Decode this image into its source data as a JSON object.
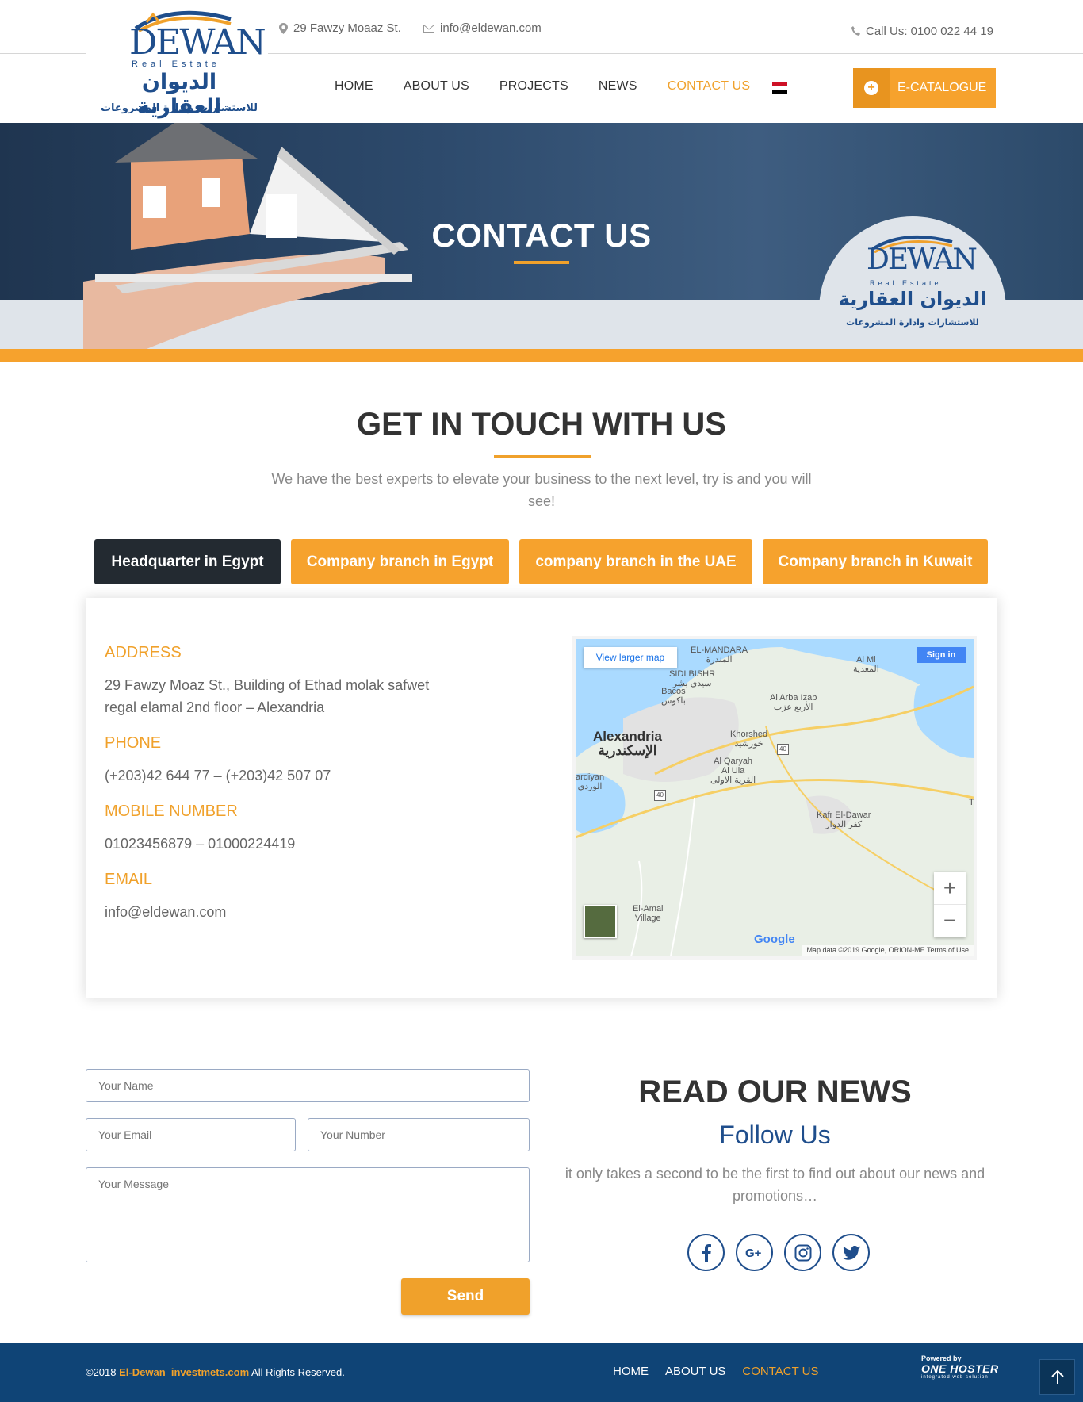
{
  "header": {
    "address": "29 Fawzy Moaaz St.",
    "email": "info@eldewan.com",
    "call": "Call Us: 0100 022 44 19",
    "logo": {
      "latin": "DEWAN",
      "subtitle": "Real Estate",
      "arabic_name": "الديوان العقارية",
      "arabic_tagline": "للاستشارات وادارة المشروعات"
    }
  },
  "nav": {
    "items": [
      {
        "label": "HOME"
      },
      {
        "label": "ABOUT US"
      },
      {
        "label": "PROJECTS"
      },
      {
        "label": "NEWS"
      },
      {
        "label": "CONTACT US",
        "active": true
      }
    ],
    "flag": "egypt-flag",
    "ecatalogue": "E-CATALOGUE"
  },
  "hero": {
    "title": "CONTACT US"
  },
  "contact": {
    "title": "GET IN TOUCH WITH US",
    "intro": "We have the best experts to elevate your business to the next level, try is and you will see!",
    "tabs": [
      {
        "label": "Headquarter in Egypt",
        "active": true
      },
      {
        "label": "Company branch in Egypt"
      },
      {
        "label": "company branch in the UAE"
      },
      {
        "label": "Company branch in Kuwait"
      }
    ],
    "address_label": "ADDRESS",
    "address_line1": "29 Fawzy Moaz St., Building of Ethad molak safwet",
    "address_line2": "regal elamal 2nd floor – Alexandria",
    "phone_label": "PHONE",
    "phone": "(+203)42 644 77 – (+203)42 507 07",
    "mobile_label": "MOBILE NUMBER",
    "mobile": "01023456879 – 01000224419",
    "email_label": "EMAIL",
    "email": "info@eldewan.com"
  },
  "map": {
    "view_larger": "View larger map",
    "sign_in": "Sign in",
    "labels": {
      "mandara": "EL-MANDARA",
      "mandara_ar": "المندرة",
      "sidi_bishr": "SIDI BISHR",
      "sidi_bishr_ar": "سيدي بشر",
      "al_mi": "Al Mi",
      "al_mi_ar": "المعدية",
      "bacos": "Bacos",
      "bacos_ar": "باكوس",
      "arba_izab": "Al Arba Izab",
      "arba_izab_ar": "الأربع عزب",
      "alexandria": "Alexandria",
      "alexandria_ar": "الإسكندرية",
      "khorshed": "Khorshed",
      "khorshed_ar": "خورشيد",
      "qaryah1": "Al Qaryah",
      "qaryah2": "Al Ula",
      "qaryah_ar": "القرية الاولى",
      "ardiyan": "ardiyan",
      "ardiyan_ar": "الوردي",
      "kafr": "Kafr El-Dawar",
      "kafr_ar": "كفر الدوار",
      "amal1": "El-Amal",
      "amal2": "Village",
      "road1": "40",
      "road2": "40",
      "t": "T"
    },
    "zoom_in": "+",
    "zoom_out": "−",
    "google": "Google",
    "credits": "Map data ©2019 Google, ORION-ME    Terms of Use"
  },
  "form": {
    "name_placeholder": "Your Name",
    "email_placeholder": "Your Email",
    "number_placeholder": "Your Number",
    "message_placeholder": "Your Message",
    "send": "Send"
  },
  "news": {
    "title": "READ OUR NEWS",
    "follow": "Follow Us",
    "text": "it only takes a second to be the first to find out about our news and promotions…",
    "social": [
      "facebook-icon",
      "google-plus-icon",
      "instagram-icon",
      "twitter-icon"
    ]
  },
  "footer": {
    "copy_year": "©2018",
    "copy_site": "El-Dewan_investmets.com",
    "copy_rest": "All Rights Reserved.",
    "nav": [
      {
        "label": "HOME"
      },
      {
        "label": "ABOUT US"
      },
      {
        "label": "CONTACT US",
        "active": true
      }
    ],
    "powered_by": "Powered by",
    "powered_name": "ONE HOSTER",
    "powered_tag": "integrated web solution"
  },
  "colors": {
    "accent": "#f6a22d",
    "brand_blue": "#1f4e8c",
    "dark_tab": "#232a31",
    "footer": "#0f4476"
  }
}
